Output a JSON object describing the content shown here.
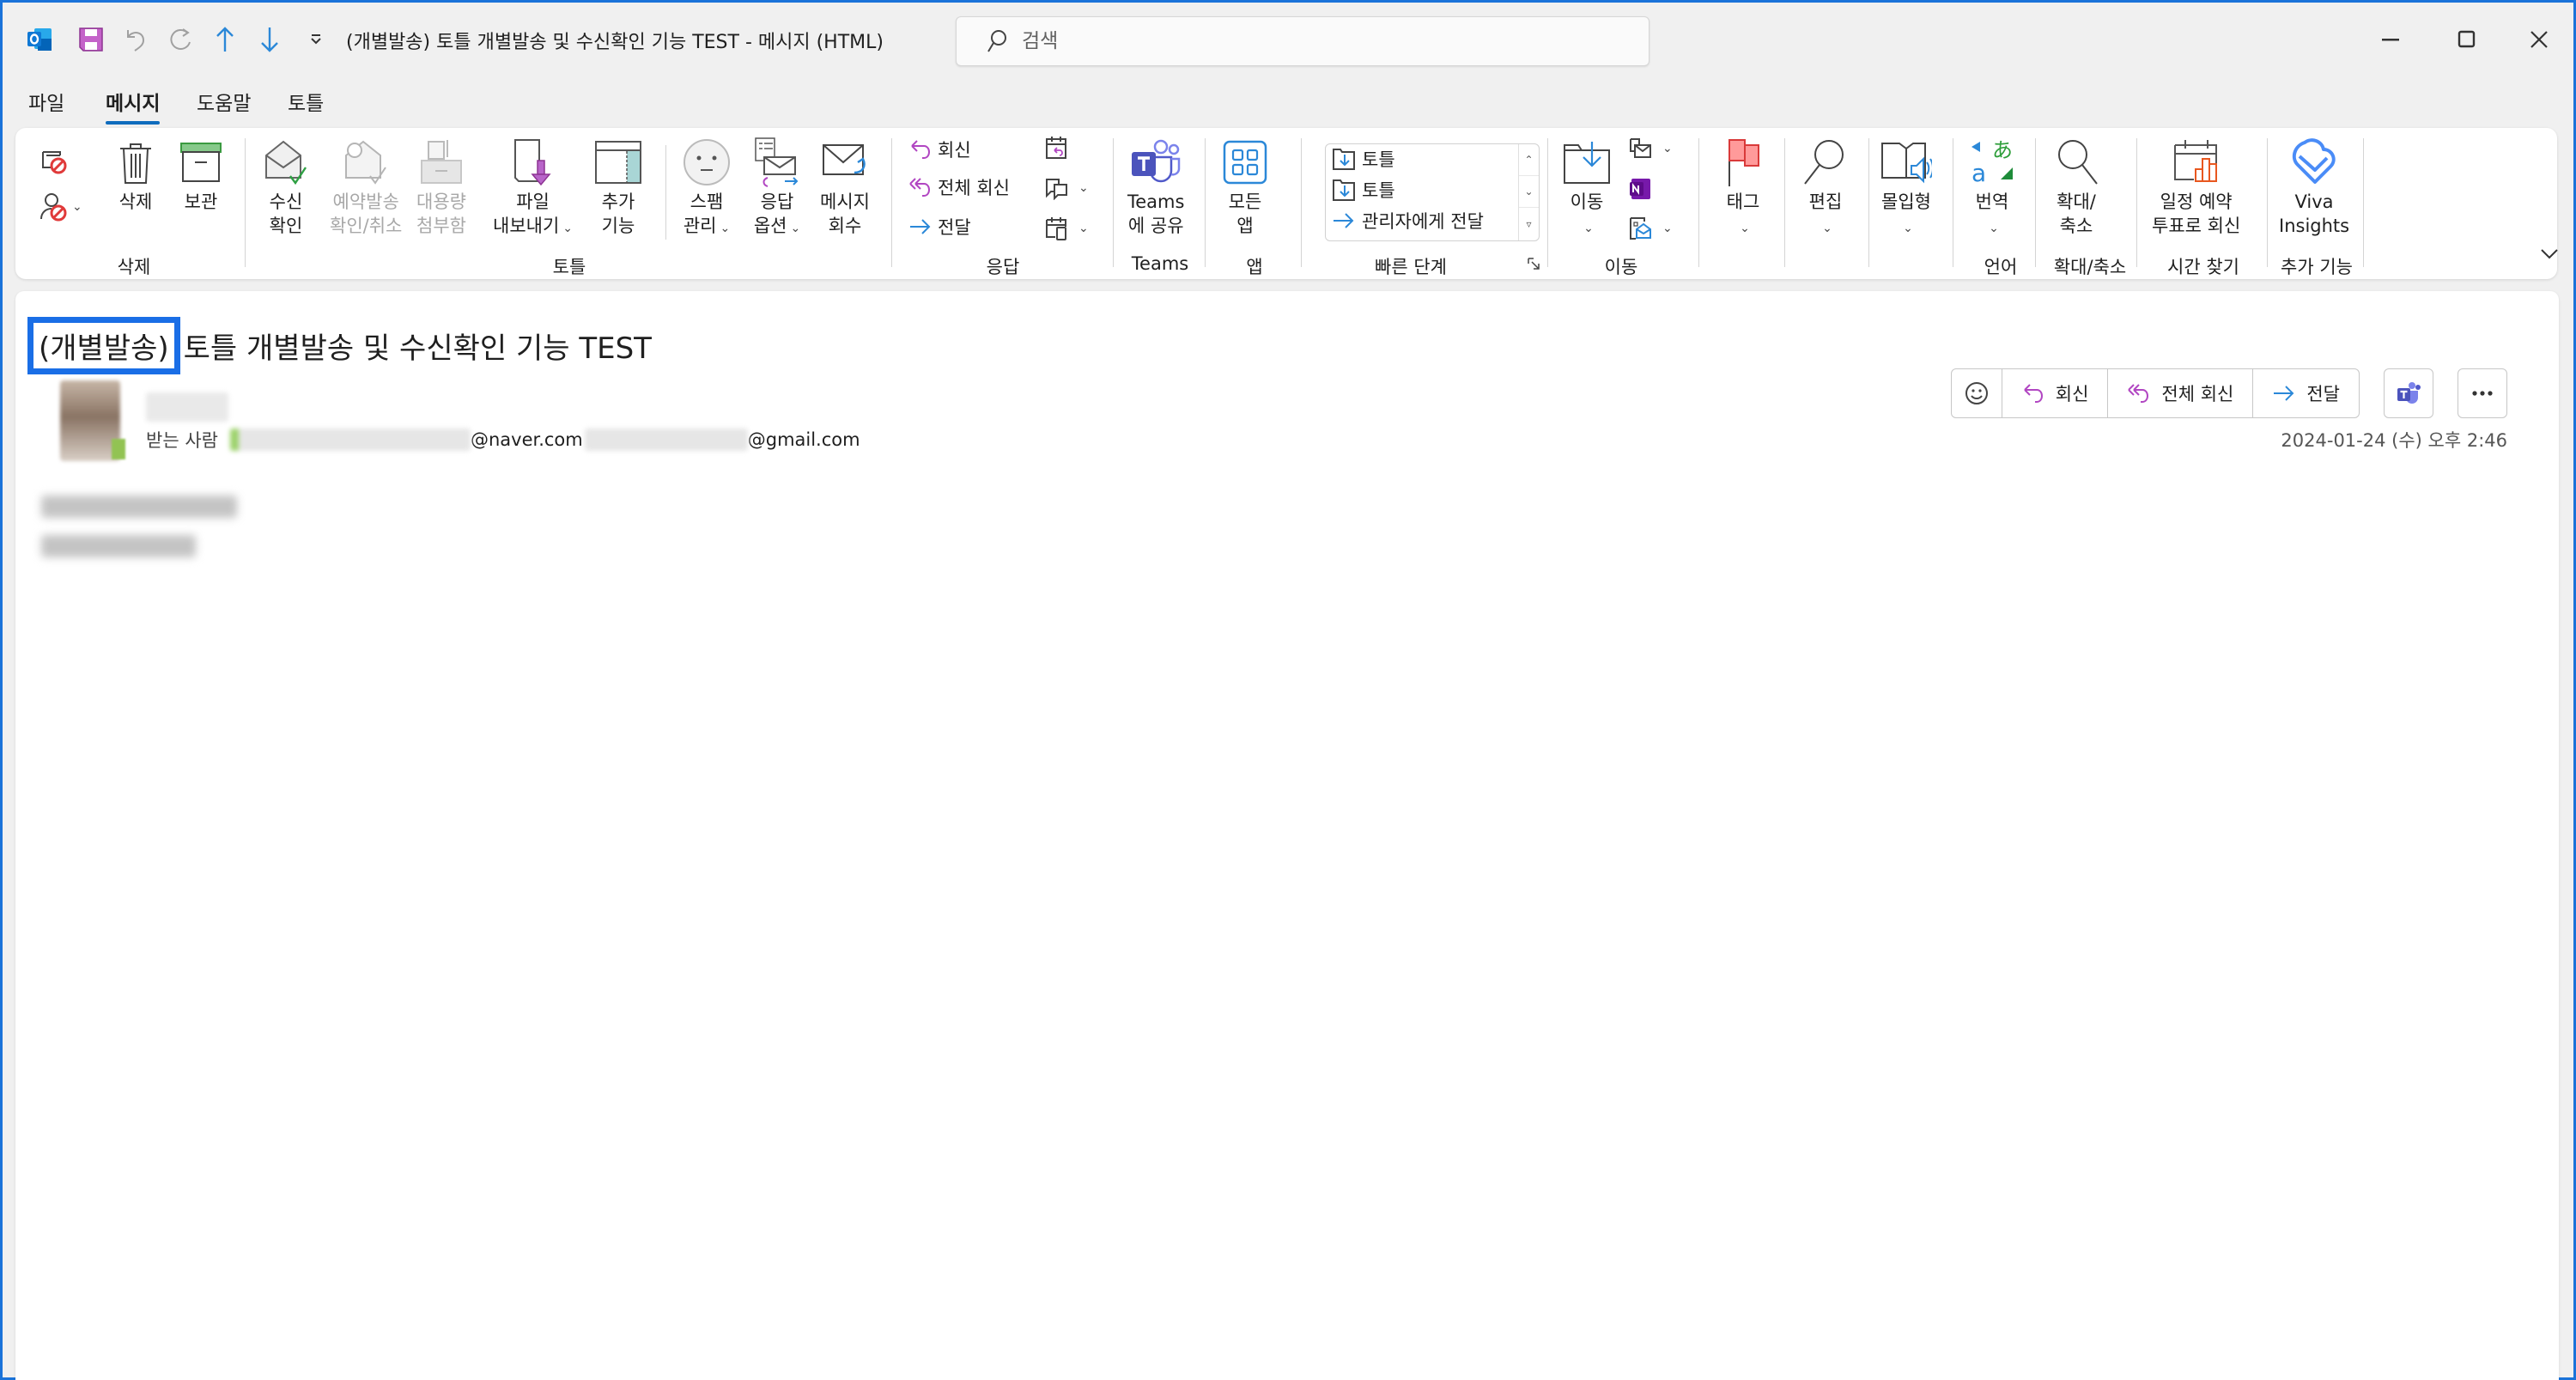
{
  "window": {
    "title": "(개별발송) 토틀 개별발송 및 수신확인 기능 TEST  -  메시지 (HTML)",
    "search_placeholder": "검색"
  },
  "quick_access": [
    {
      "icon": "outlook-icon"
    },
    {
      "icon": "save-icon"
    },
    {
      "icon": "undo-icon"
    },
    {
      "icon": "redo-icon"
    },
    {
      "icon": "previous-item-icon"
    },
    {
      "icon": "next-item-icon"
    },
    {
      "icon": "customize-qat-icon"
    }
  ],
  "menu_tabs": [
    {
      "label": "파일",
      "active": false
    },
    {
      "label": "메시지",
      "active": true
    },
    {
      "label": "도움말",
      "active": false
    },
    {
      "label": "토틀",
      "active": false
    }
  ],
  "ribbon": {
    "groups": {
      "delete": "삭제",
      "totle": "토틀",
      "respond": "응답",
      "teams": "Teams",
      "apps": "앱",
      "quick_steps": "빠른 단계",
      "move": "이동",
      "language": "언어",
      "zoom": "확대/축소",
      "find_time": "시간 찾기",
      "addins": "추가 기능"
    },
    "buttons": {
      "delete": "삭제",
      "archive": "보관",
      "read_receipt_1": "수신",
      "read_receipt_2": "확인",
      "scheduled_1": "예약발송",
      "scheduled_2": "확인/취소",
      "large_attach_1": "대용량",
      "large_attach_2": "첨부함",
      "export_1": "파일",
      "export_2": "내보내기",
      "addon_1": "추가",
      "addon_2": "기능",
      "spam_1": "스팸",
      "spam_2": "관리",
      "reply_opt_1": "응답",
      "reply_opt_2": "옵션",
      "recall_1": "메시지",
      "recall_2": "회수",
      "reply": "회신",
      "reply_all": "전체 회신",
      "forward": "전달",
      "teams_1": "Teams",
      "teams_2": "에 공유",
      "all_apps_1": "모든",
      "all_apps_2": "앱",
      "move": "이동",
      "tags": "태그",
      "editing": "편집",
      "immersive": "몰입형",
      "translate": "번역",
      "zoom_1": "확대/",
      "zoom_2": "축소",
      "poll_1": "일정 예약",
      "poll_2": "투표로 회신",
      "viva_1": "Viva",
      "viva_2": "Insights"
    },
    "quick_steps": [
      {
        "label": "토틀",
        "icon": "move-to-folder-icon"
      },
      {
        "label": "토틀",
        "icon": "move-to-folder-icon"
      },
      {
        "label": "관리자에게 전달",
        "icon": "forward-arrow-icon"
      }
    ]
  },
  "message": {
    "subject_tag": "(개별발송)",
    "subject_rest": "토틀 개별발송 및 수신확인 기능 TEST",
    "to_label": "받는 사람",
    "to_domain_1": "@naver.com",
    "to_domain_2": "@gmail.com",
    "datetime": "2024-01-24 (수) 오후 2:46",
    "actions": {
      "reply": "회신",
      "reply_all": "전체 회신",
      "forward": "전달"
    }
  },
  "colors": {
    "accent": "#0f6cbd",
    "highlight_box": "#1a6ee6",
    "reply_purple": "#b146c2",
    "forward_blue": "#2b88d8"
  }
}
